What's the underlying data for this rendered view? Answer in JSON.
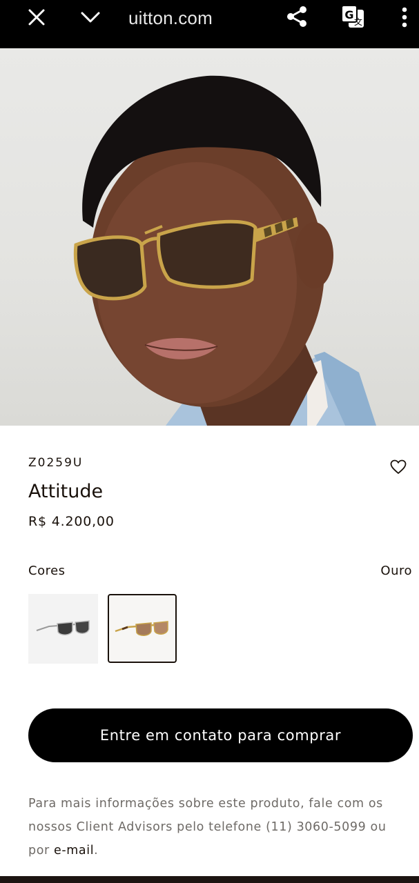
{
  "browser": {
    "url_text": "uitton.com",
    "icons": [
      "close-icon",
      "chevron-down-icon",
      "share-icon",
      "translate-icon",
      "more-vertical-icon"
    ]
  },
  "hero": {
    "image": "model wearing gold aviator sunglasses"
  },
  "product": {
    "sku": "Z0259U",
    "title": "Attitude",
    "price": "R$ 4.200,00"
  },
  "colors": {
    "label": "Cores",
    "selected": "Ouro",
    "swatches": [
      {
        "name": "silver-frame-swatch",
        "selected": false
      },
      {
        "name": "gold-frame-swatch",
        "selected": true
      }
    ]
  },
  "cta": {
    "label": "Entre em contato para comprar"
  },
  "info": {
    "text": "Para mais informações sobre este produto, fale com os nossos Client Advisors pelo telefone (11) 3060-5099 ou por ",
    "link": "e-mail",
    "suffix": "."
  },
  "theme": {
    "topbar": "#000000",
    "text": "#19110b",
    "muted": "#6e6a66",
    "button": "#000000"
  }
}
